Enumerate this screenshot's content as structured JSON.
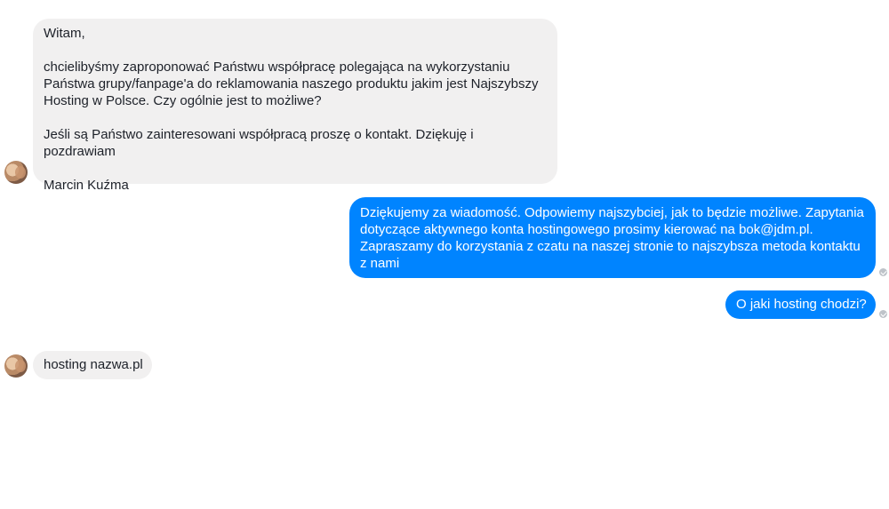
{
  "messages": [
    {
      "direction": "incoming",
      "paragraphs": [
        "Witam,",
        "chcielibyśmy zaproponować Państwu współpracę polegająca na wykorzystaniu Państwa grupy/fanpage'a do reklamowania naszego produktu jakim jest Najszybszy Hosting w Polsce. Czy ogólnie jest to możliwe?",
        "Jeśli są Państwo zainteresowani współpracą proszę o kontakt. Dziękuję i pozdrawiam",
        "Marcin Kuźma"
      ]
    },
    {
      "direction": "outgoing",
      "text": "Dziękujemy za wiadomość. Odpowiemy najszybciej, jak to będzie możliwe. Zapytania dotyczące aktywnego konta hostingowego prosimy kierować na bok@jdm.pl. Zapraszamy do korzystania z czatu na naszej stronie to najszybsza metoda kontaktu z nami"
    },
    {
      "direction": "outgoing",
      "text": "O jaki hosting chodzi?"
    },
    {
      "direction": "incoming",
      "text": "hosting nazwa.pl"
    }
  ],
  "colors": {
    "incoming_bubble": "#f1f0f0",
    "outgoing_bubble": "#0084ff",
    "seen_indicator": "#bec3c9"
  },
  "icons": {
    "avatar": "contact-avatar",
    "seen": "seen-check-icon"
  }
}
